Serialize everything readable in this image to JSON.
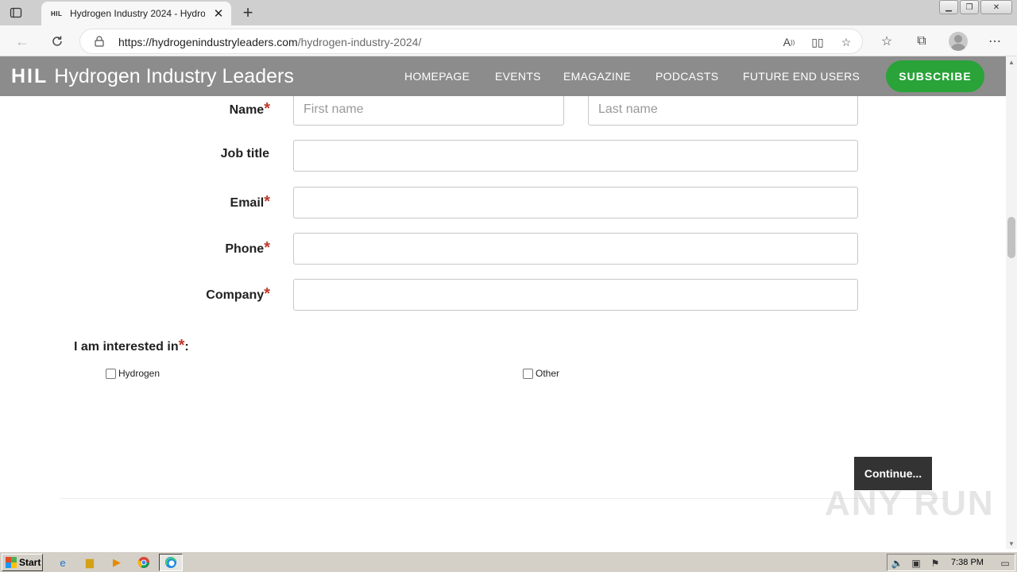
{
  "browser": {
    "tab_favicon": "HIL",
    "tab_title": "Hydrogen Industry 2024 - Hydrogen Industry Leaders",
    "url_host": "https://hydrogenindustryleaders.com",
    "url_path": "/hydrogen-industry-2024/"
  },
  "site": {
    "logo_mark": "HIL",
    "logo_text": "Hydrogen Industry Leaders",
    "nav": [
      "HOMEPAGE",
      "EVENTS",
      "EMAGAZINE",
      "PODCASTS",
      "FUTURE END USERS"
    ],
    "subscribe_label": "SUBSCRIBE"
  },
  "form": {
    "name_label": "Name",
    "first_name_placeholder": "First name",
    "last_name_placeholder": "Last name",
    "job_title_label": "Job title",
    "email_label": "Email",
    "phone_label": "Phone",
    "company_label": "Company",
    "required_mark": "*",
    "interest_label": "I am interested in",
    "interest_suffix": ":",
    "options": [
      "Hydrogen",
      "Other"
    ],
    "continue_label": "Continue..."
  },
  "watermark": "ANY RUN",
  "taskbar": {
    "start_label": "Start",
    "clock": "7:38 PM"
  },
  "colors": {
    "header_bg": "#8c8c8c",
    "subscribe_bg": "#2aa339",
    "required": "#c0392b",
    "continue_bg": "#333333"
  }
}
